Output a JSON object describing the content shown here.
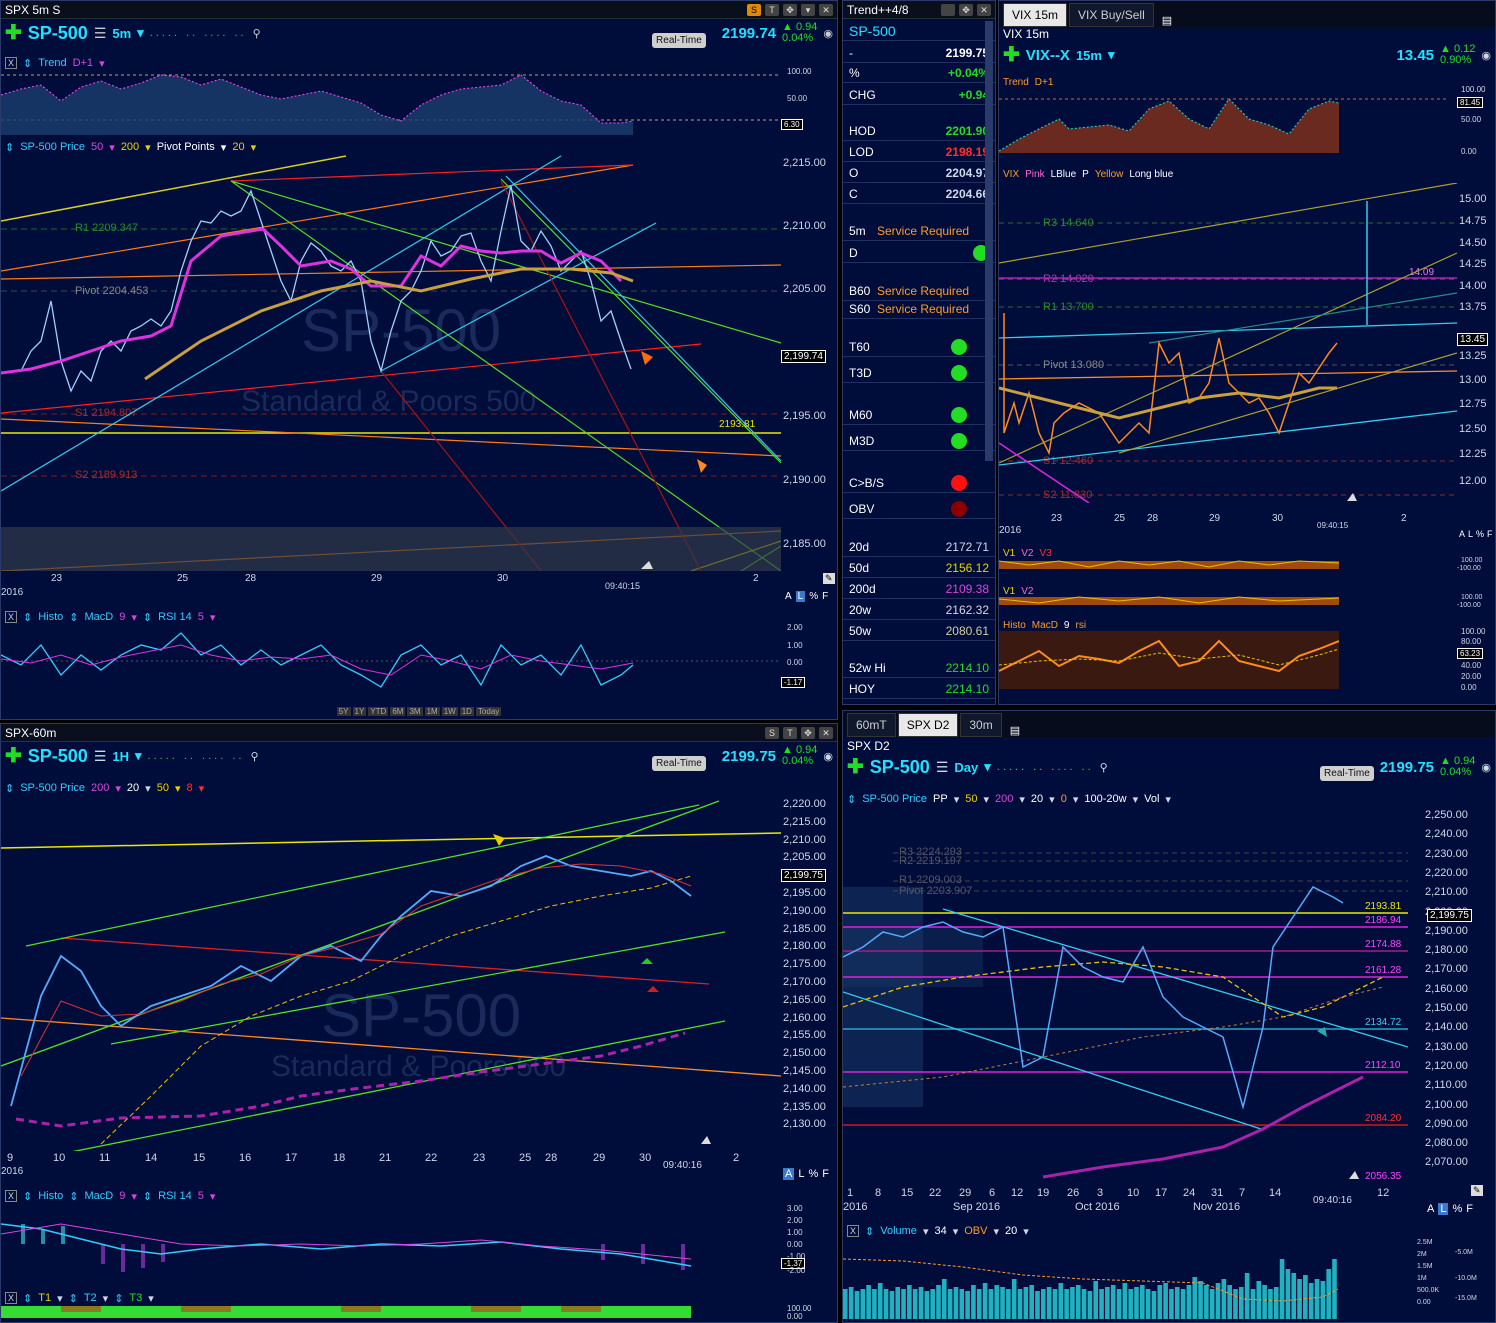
{
  "p1": {
    "title": "SPX 5m S",
    "symbol": "SP-500",
    "interval": "5m",
    "realtime": "Real-Time",
    "price": "2199.74",
    "change": "0.94",
    "change_pct": "0.04%",
    "trend_label": "Trend",
    "trend_param": "D+1",
    "price_label": "SP-500 Price",
    "p50": "50",
    "p200": "200",
    "pivot_label": "Pivot Points",
    "p20": "20",
    "r1": "R1 2209.347",
    "pivot": "Pivot 2204.453",
    "s1": "S1 2194.807",
    "s2": "S2 2189.913",
    "watermark": "SP-500",
    "watermark2": "Standard & Poors 500",
    "yaxis": [
      "2,215.00",
      "2,210.00",
      "2,205.00",
      "2,200.00",
      "2,195.00",
      "2,190.00",
      "2,185.00"
    ],
    "price_tag": "2,199.74",
    "level_tag": "2193.81",
    "xaxis": [
      "23",
      "25",
      "28",
      "29",
      "30",
      "2"
    ],
    "year": "2016",
    "time": "09:40:15",
    "trend_scale": [
      "100.00",
      "50.00",
      "6.30"
    ],
    "histo": "Histo",
    "macd": "MacD",
    "macd_p": "9",
    "rsi": "RSI 14",
    "rsi_p": "5",
    "osc_scale": [
      "2.00",
      "1.00",
      "0.00",
      "-1.17"
    ],
    "alf": [
      "A",
      "L",
      "%",
      "F"
    ],
    "periods": [
      "5Y",
      "1Y",
      "YTD",
      "6M",
      "3M",
      "1M",
      "1W",
      "1D",
      "Today"
    ]
  },
  "trend": {
    "title": "Trend++4/8",
    "symbol": "SP-500",
    "rows": [
      {
        "label": "-",
        "value": "2199.75",
        "color": "#ffffff"
      },
      {
        "label": "%",
        "value": "+0.04%",
        "color": "#22dd22"
      },
      {
        "label": "CHG",
        "value": "+0.94",
        "color": "#22dd22"
      },
      {
        "label": "HOD",
        "value": "2201.90",
        "color": "#22dd22"
      },
      {
        "label": "LOD",
        "value": "2198.19",
        "color": "#ff3030"
      },
      {
        "label": "O",
        "value": "2204.97",
        "color": "#cfd8e6"
      },
      {
        "label": "C",
        "value": "2204.66",
        "color": "#cfd8e6"
      }
    ],
    "service_rows": [
      {
        "label": "5m",
        "value": "Service Required"
      },
      {
        "label": "B60",
        "value": "Service Required"
      },
      {
        "label": "S60",
        "value": "Service Required"
      }
    ],
    "d_label": "D",
    "signals": [
      {
        "label": "T60",
        "color": "#22dd22"
      },
      {
        "label": "T3D",
        "color": "#22dd22"
      },
      {
        "label": "M60",
        "color": "#22dd22"
      },
      {
        "label": "M3D",
        "color": "#22dd22"
      },
      {
        "label": "C>B/S",
        "color": "#ff1010"
      },
      {
        "label": "OBV",
        "color": "#8a0000"
      }
    ],
    "mas": [
      {
        "label": "20d",
        "value": "2172.71",
        "color": "#cfd8e6"
      },
      {
        "label": "50d",
        "value": "2156.12",
        "color": "#e8d000"
      },
      {
        "label": "200d",
        "value": "2109.38",
        "color": "#dd44dd"
      },
      {
        "label": "20w",
        "value": "2162.32",
        "color": "#cfd8e6"
      },
      {
        "label": "50w",
        "value": "2080.61",
        "color": "#cfcf99"
      },
      {
        "label": "52w Hi",
        "value": "2214.10",
        "color": "#22dd22"
      },
      {
        "label": "HOY",
        "value": "2214.10",
        "color": "#22dd22"
      }
    ]
  },
  "vix": {
    "tab1": "VIX 15m",
    "tab2": "VIX Buy/Sell",
    "title": "VIX 15m",
    "symbol": "VIX--X",
    "interval": "15m",
    "price": "13.45",
    "change": "0.12",
    "change_pct": "0.90%",
    "trend": "Trend",
    "trend_p": "D+1",
    "trend_scale": [
      "100.00",
      "81.45",
      "50.00",
      "0.00"
    ],
    "legend": [
      "VIX",
      "Pink",
      "LBlue",
      "P",
      "Yellow",
      "Long blue"
    ],
    "r3": "R3 14.640",
    "r2": "R2 14.020",
    "r1": "R1 13.700",
    "pivot": "Pivot 13.080",
    "s1": "S1 12.460",
    "s2": "S2 11.830",
    "level": "14.09",
    "yaxis": [
      "15.00",
      "14.75",
      "14.50",
      "14.25",
      "14.00",
      "13.75",
      "13.50",
      "13.25",
      "13.00",
      "12.75",
      "12.50",
      "12.25",
      "12.00"
    ],
    "price_tag": "13.45",
    "xaxis": [
      "23",
      "25",
      "28",
      "29",
      "30",
      "2"
    ],
    "year": "2016",
    "time": "09:40:15",
    "v1": "V1",
    "v2": "V2",
    "v3": "V3",
    "vol_scale": [
      "100.00",
      "-100.00"
    ],
    "histo": "Histo",
    "macd": "MacD",
    "macd_p": "9",
    "rsi": "rsi",
    "osc_scale": [
      "100.00",
      "80.00",
      "63.23",
      "40.00",
      "20.00",
      "0.00"
    ],
    "alf": [
      "A",
      "L",
      "%",
      "F"
    ]
  },
  "p60": {
    "title": "SPX-60m",
    "symbol": "SP-500",
    "interval": "1H",
    "realtime": "Real-Time",
    "price": "2199.75",
    "change": "0.94",
    "change_pct": "0.04%",
    "price_label": "SP-500 Price",
    "p200": "200",
    "p20": "20",
    "p50": "50",
    "p8": "8",
    "watermark": "SP-500",
    "watermark2": "Standard & Poors 500",
    "yaxis": [
      "2,220.00",
      "2,215.00",
      "2,210.00",
      "2,205.00",
      "2,200.00",
      "2,195.00",
      "2,190.00",
      "2,185.00",
      "2,180.00",
      "2,175.00",
      "2,170.00",
      "2,165.00",
      "2,160.00",
      "2,155.00",
      "2,150.00",
      "2,145.00",
      "2,140.00",
      "2,135.00",
      "2,130.00"
    ],
    "price_tag": "2,199.75",
    "xaxis": [
      "9",
      "10",
      "11",
      "14",
      "15",
      "16",
      "17",
      "18",
      "21",
      "22",
      "23",
      "25",
      "28",
      "29",
      "30",
      "2"
    ],
    "year": "2016",
    "time": "09:40:16",
    "histo": "Histo",
    "macd": "MacD",
    "macd_p": "9",
    "rsi": "RSI 14",
    "rsi_p": "5",
    "osc_scale": [
      "3.00",
      "2.00",
      "1.00",
      "0.00",
      "-1.00",
      "-1.37",
      "-2.00"
    ],
    "t1": "T1",
    "t2": "T2",
    "t3": "T3",
    "t_scale": [
      "100.00",
      "0.00"
    ],
    "alf": [
      "A",
      "L",
      "%",
      "F"
    ]
  },
  "pd": {
    "tab1": "60mT",
    "tab2": "SPX D2",
    "tab3": "30m",
    "title": "SPX D2",
    "symbol": "SP-500",
    "interval": "Day",
    "realtime": "Real-Time",
    "price": "2199.75",
    "change": "0.94",
    "change_pct": "0.04%",
    "price_label": "SP-500 Price",
    "pp": "PP",
    "p50": "50",
    "p200": "200",
    "p20": "20",
    "p0": "0",
    "p100": "100-20w",
    "vol": "Vol",
    "r3": "R3 2224.293",
    "r2": "R2 2219.197",
    "r1": "R1 2209.003",
    "pivot": "Pivot 2203.907",
    "levels": [
      "2193.81",
      "2186.94",
      "2174.88",
      "2161.28",
      "2134.72",
      "2112.10",
      "2084.20",
      "2056.35"
    ],
    "yaxis": [
      "2,250.00",
      "2,240.00",
      "2,230.00",
      "2,220.00",
      "2,210.00",
      "2,200.00",
      "2,190.00",
      "2,180.00",
      "2,170.00",
      "2,160.00",
      "2,150.00",
      "2,140.00",
      "2,130.00",
      "2,120.00",
      "2,110.00",
      "2,100.00",
      "2,090.00",
      "2,080.00",
      "2,070.00"
    ],
    "price_tag": "2,199.75",
    "xaxis": [
      "1",
      "8",
      "15",
      "22",
      "29",
      "6",
      "12",
      "19",
      "26",
      "3",
      "10",
      "17",
      "24",
      "31",
      "7",
      "14",
      "12"
    ],
    "months": [
      "2016",
      "Sep 2016",
      "Oct 2016",
      "Nov 2016"
    ],
    "time": "09:40:16",
    "volume": "Volume",
    "vol_p": "34",
    "obv": "OBV",
    "obv_p": "20",
    "vol_scale": [
      "2.5M",
      "2M",
      "1.5M",
      "1M",
      "500.0K",
      "0.00"
    ],
    "obv_scale": [
      "-5.0M",
      "-10.0M",
      "-15.0M"
    ],
    "alf": [
      "A",
      "L",
      "%",
      "F"
    ]
  }
}
